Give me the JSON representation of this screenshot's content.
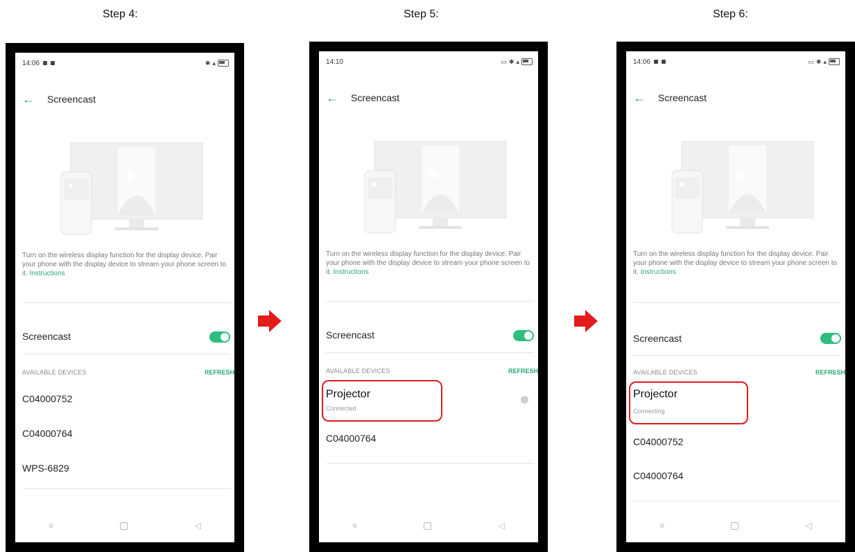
{
  "steps": [
    {
      "label": "Step 4:",
      "status_time": "14:06",
      "screen_title": "Screencast",
      "description": "Turn on the wireless display function for the display device. Pair your phone with the display device to stream your phone screen to it.",
      "description_link": "Instructions",
      "toggle_label": "Screencast",
      "toggle_on": true,
      "section_header": "AVAILABLE DEVICES",
      "refresh_label": "REFRESH",
      "devices": [
        "C04000752",
        "C04000764",
        "WPS-6829"
      ]
    },
    {
      "label": "Step 5:",
      "status_time": "14:10",
      "screen_title": "Screencast",
      "description": "Turn on the wireless display function for the display device. Pair your phone with the display device to stream your phone screen to it.",
      "description_link": "Instructions",
      "toggle_label": "Screencast",
      "toggle_on": true,
      "section_header": "AVAILABLE DEVICES",
      "refresh_label": "REFRESH",
      "highlighted_device": {
        "name": "Projector",
        "status": "Connected"
      },
      "devices": [
        "C04000764"
      ]
    },
    {
      "label": "Step 6:",
      "status_time": "14:06",
      "screen_title": "Screencast",
      "description": "Turn on the wireless display function for the display device. Pair your phone with the display device to stream your phone screen to it.",
      "description_link": "Instructions",
      "toggle_label": "Screencast",
      "toggle_on": true,
      "section_header": "AVAILABLE DEVICES",
      "refresh_label": "REFRESH",
      "highlighted_device": {
        "name": "Projector",
        "status": "Connecting"
      },
      "devices": [
        "C04000752",
        "C04000764"
      ]
    }
  ],
  "colors": {
    "accent": "#2aa876",
    "toggle": "#2dbd7e",
    "highlight": "#e21b1b",
    "arrow": "#e21b1b"
  },
  "icons": [
    "back-arrow-icon",
    "menu-nav-icon",
    "home-nav-icon",
    "back-nav-icon",
    "info-icon",
    "red-arrow-icon"
  ]
}
